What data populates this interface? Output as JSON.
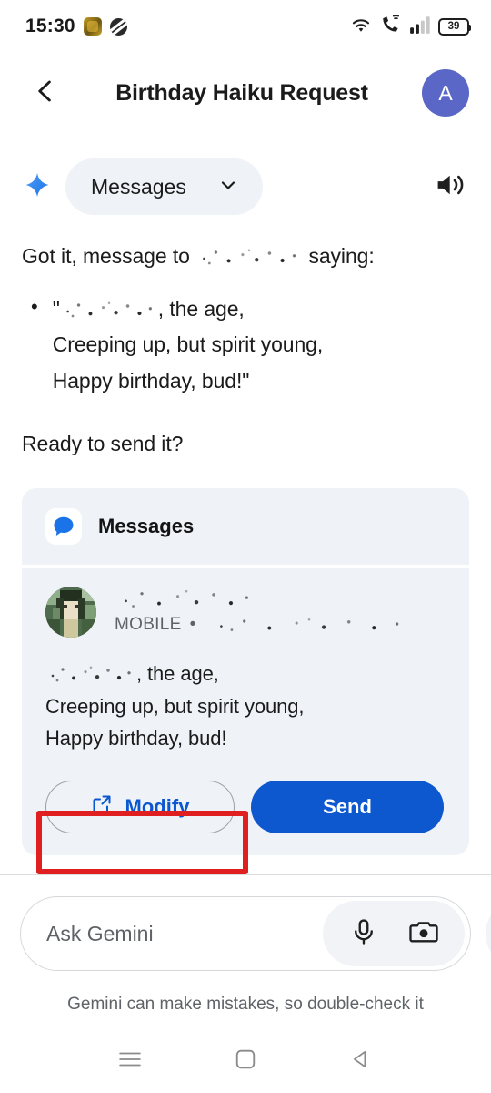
{
  "status_bar": {
    "time": "15:30",
    "battery_level": "39",
    "icons": [
      "notification-badge-icon",
      "notification-badge-icon",
      "wifi-icon",
      "wifi-calling-icon",
      "signal-bars-icon",
      "battery-icon"
    ]
  },
  "header": {
    "title": "Birthday Haiku Request",
    "back_icon": "chevron-left-icon",
    "avatar_initial": "A"
  },
  "source_chip": {
    "sparkle_icon": "gemini-sparkle-icon",
    "label": "Messages",
    "chevron_icon": "chevron-down-icon",
    "speaker_icon": "volume-speaker-icon"
  },
  "answer": {
    "intro_before": "Got it, message to",
    "intro_redacted": "[REDACTED NAME]",
    "intro_after": "saying:",
    "bullet_marker": "•",
    "haiku_line1_prefix": "\"",
    "haiku_line1_redacted": "[REDACTED NAME]",
    "haiku_line1_suffix": ", the age,",
    "haiku_line2": "Creeping up, but spirit young,",
    "haiku_line3": "Happy birthday, bud!\"",
    "ready_prompt": "Ready to send it?"
  },
  "card": {
    "app_icon": "google-messages-icon",
    "app_name": "Messages",
    "contact": {
      "avatar": "contact-photo-redacted",
      "name_redacted": "[REDACTED CONTACT NAME]",
      "type_label": "MOBILE",
      "separator": "•",
      "phone_redacted": "[REDACTED PHONE NUMBER]"
    },
    "message": {
      "line1_redacted": "[REDACTED NAME]",
      "line1_suffix": ", the age,",
      "line2": "Creeping up, but spirit young,",
      "line3": "Happy birthday, bud!"
    },
    "actions": {
      "modify_label": "Modify",
      "modify_icon": "external-link-icon",
      "send_label": "Send"
    }
  },
  "composer": {
    "placeholder": "Ask Gemini",
    "value": "",
    "mic_icon": "microphone-icon",
    "camera_icon": "camera-icon",
    "live_icon": "gemini-live-waveform-icon"
  },
  "disclaimer": "Gemini can make mistakes, so double-check it",
  "nav_bar": {
    "recents_icon": "recents-menu-icon",
    "home_icon": "home-square-icon",
    "back_icon": "back-triangle-icon"
  },
  "annotation": {
    "highlight_target": "Modify",
    "highlight_color": "#e02020"
  },
  "colors": {
    "accent_blue": "#0d57cf",
    "link_blue": "#0b57d0",
    "card_bg": "#eff2f7",
    "avatar_purple": "#5a67c7",
    "text_primary": "#1b1b1b",
    "text_secondary": "#5f6368"
  }
}
